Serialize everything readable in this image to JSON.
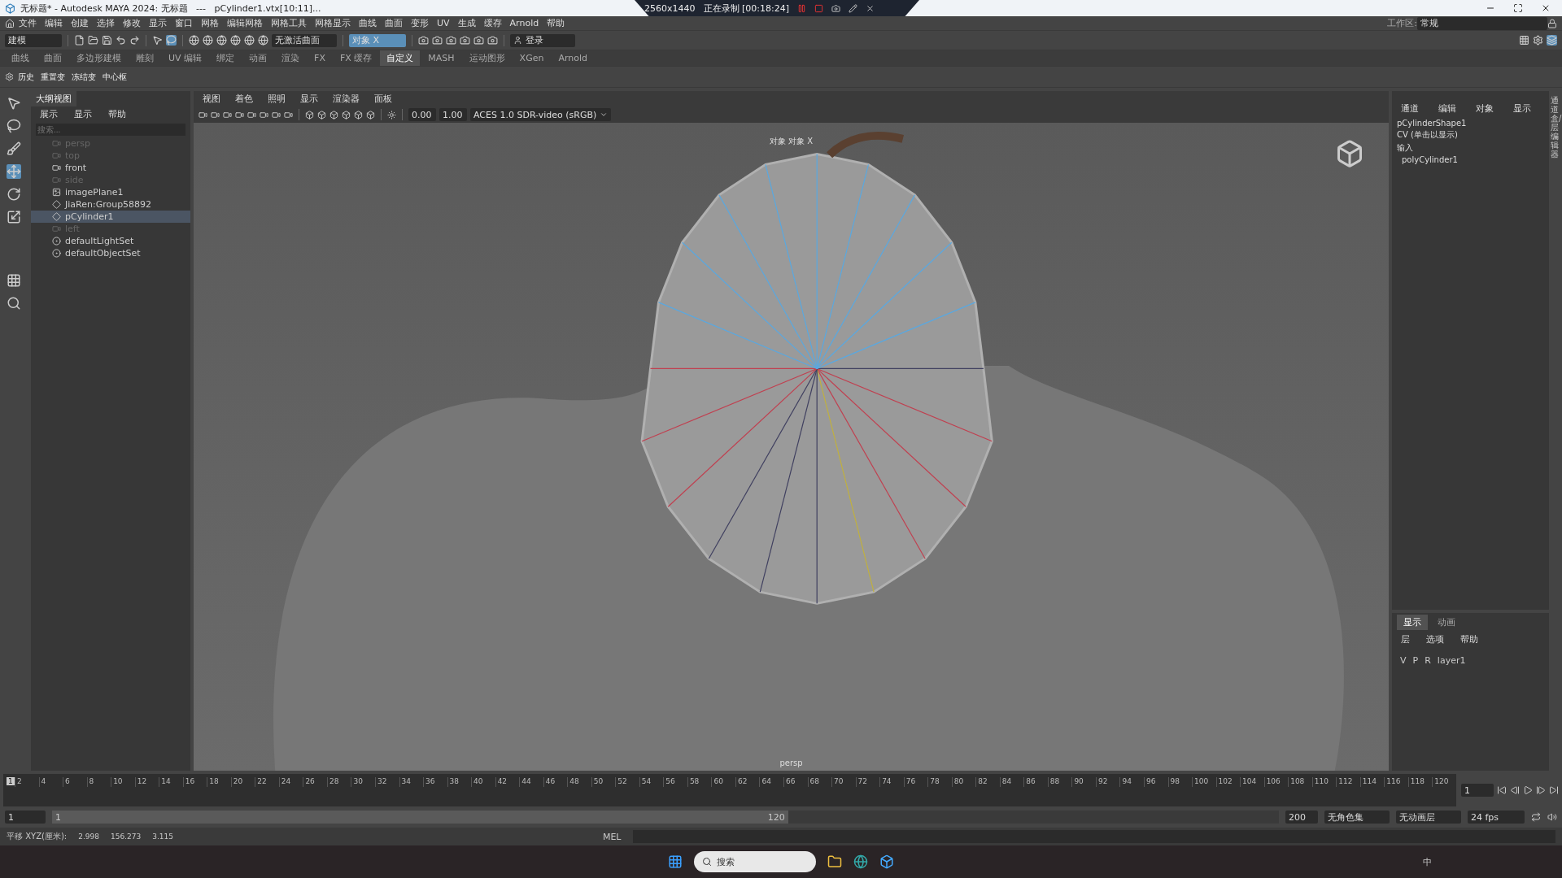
{
  "title_bar": {
    "title": "无标题* - Autodesk MAYA 2024: 无标题   ---   pCylinder1.vtx[10:11]...",
    "recorder": {
      "resolution": "2560x1440",
      "status": "正在录制 [00:18:24]"
    }
  },
  "menu": [
    "文件",
    "编辑",
    "创建",
    "选择",
    "修改",
    "显示",
    "窗口",
    "网格",
    "编辑网格",
    "网格工具",
    "网格显示",
    "曲线",
    "曲面",
    "变形",
    "UV",
    "生成",
    "缓存",
    "Arnold",
    "帮助"
  ],
  "workspace": {
    "label": "工作区:",
    "value": "常规"
  },
  "toolbar": {
    "mode": "建模",
    "surface": "无激活曲面",
    "object": "对象 X",
    "login": "登录"
  },
  "shelf_tabs": [
    {
      "label": "曲线",
      "selected": false
    },
    {
      "label": "曲面",
      "selected": false
    },
    {
      "label": "多边形建模",
      "selected": false
    },
    {
      "label": "雕刻",
      "selected": false
    },
    {
      "label": "UV 编辑",
      "selected": false
    },
    {
      "label": "绑定",
      "selected": false
    },
    {
      "label": "动画",
      "selected": false
    },
    {
      "label": "渲染",
      "selected": false
    },
    {
      "label": "FX",
      "selected": false
    },
    {
      "label": "FX 缓存",
      "selected": false
    },
    {
      "label": "自定义",
      "selected": true
    },
    {
      "label": "MASH",
      "selected": false
    },
    {
      "label": "运动图形",
      "selected": false
    },
    {
      "label": "XGen",
      "selected": false
    },
    {
      "label": "Arnold",
      "selected": false
    }
  ],
  "shelf_buttons": [
    "历史",
    "重置变",
    "冻结变",
    "中心枢"
  ],
  "outliner": {
    "title": "大纲视图",
    "menu": [
      "展示",
      "显示",
      "帮助"
    ],
    "placeholder": "搜索...",
    "items": [
      {
        "label": "persp",
        "kind": "camera",
        "dimmed": true,
        "selected": false
      },
      {
        "label": "top",
        "kind": "camera",
        "dimmed": true,
        "selected": false
      },
      {
        "label": "front",
        "kind": "camera",
        "dimmed": false,
        "selected": false
      },
      {
        "label": "side",
        "kind": "camera",
        "dimmed": true,
        "selected": false
      },
      {
        "label": "imagePlane1",
        "kind": "image",
        "dimmed": false,
        "selected": false
      },
      {
        "label": "JiaRen:Group58892",
        "kind": "group",
        "dimmed": false,
        "selected": false
      },
      {
        "label": "pCylinder1",
        "kind": "group",
        "dimmed": false,
        "selected": true
      },
      {
        "label": "left",
        "kind": "camera",
        "dimmed": true,
        "selected": false
      },
      {
        "label": "defaultLightSet",
        "kind": "set",
        "dimmed": false,
        "selected": false
      },
      {
        "label": "defaultObjectSet",
        "kind": "set",
        "dimmed": false,
        "selected": false
      }
    ]
  },
  "viewport": {
    "menu": [
      "视图",
      "着色",
      "照明",
      "显示",
      "渲染器",
      "面板"
    ],
    "exposure": "0.00",
    "gamma": "1.00",
    "color_space": "ACES 1.0 SDR-video (sRGB)",
    "hud_top": "对象 对象 X",
    "camera": "persp"
  },
  "channel_box": {
    "menu": [
      "通道",
      "编辑",
      "对象",
      "显示"
    ],
    "lines": [
      "pCylinderShape1",
      "CV (单击以显示)",
      "输入",
      "polyCylinder1"
    ],
    "side_label": "通道盒/层编辑器"
  },
  "layer_editor": {
    "tabs": [
      {
        "label": "显示",
        "selected": true
      },
      {
        "label": "动画",
        "selected": false
      }
    ],
    "menu": [
      "层",
      "选项",
      "帮助"
    ],
    "layers": [
      {
        "flags": [
          "V",
          "P",
          "R"
        ],
        "name": "layer1"
      }
    ]
  },
  "timeline": {
    "current": "1",
    "level": 0,
    "ticks": [
      "2",
      "4",
      "6",
      "8",
      "10",
      "12",
      "14",
      "16",
      "18",
      "20",
      "22",
      "24",
      "26",
      "28",
      "30",
      "32",
      "34",
      "36",
      "38",
      "40",
      "42",
      "44",
      "46",
      "48",
      "50",
      "52",
      "54",
      "56",
      "58",
      "60",
      "62",
      "64",
      "66",
      "68",
      "70",
      "72",
      "74",
      "76",
      "78",
      "80",
      "82",
      "84",
      "86",
      "88",
      "90",
      "92",
      "94",
      "96",
      "98",
      "100",
      "102",
      "104",
      "106",
      "108",
      "110",
      "112",
      "114",
      "116",
      "118",
      "120"
    ],
    "frame_field": "1"
  },
  "range": {
    "level": 0.6,
    "start": "1",
    "inner_start": "1",
    "inner_end": "120",
    "end": "200",
    "character_set": "无角色集",
    "anim_layer": "无动画层",
    "fps": "24 fps"
  },
  "status": {
    "label": "平移 XYZ(厘米):",
    "values": [
      "2.998",
      "156.273",
      "3.115"
    ],
    "mel": "MEL"
  },
  "taskbar": {
    "search": "搜索",
    "ime": "中"
  }
}
